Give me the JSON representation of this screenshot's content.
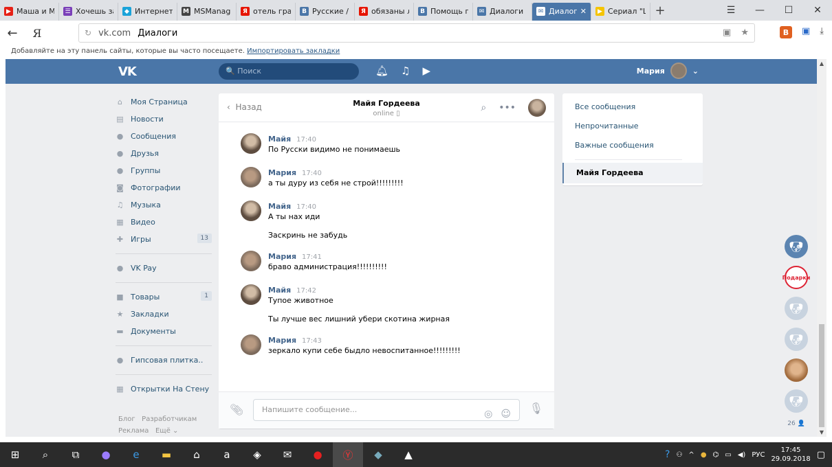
{
  "browser": {
    "tabs": [
      {
        "title": "Маша и М",
        "fav_color": "#e62117",
        "fav_glyph": "▶"
      },
      {
        "title": "Хочешь за",
        "fav_color": "#7a3fb8",
        "fav_glyph": "☰"
      },
      {
        "title": "Интернет",
        "fav_color": "#1aa3d9",
        "fav_glyph": "◆"
      },
      {
        "title": "MSManag",
        "fav_color": "#444444",
        "fav_glyph": "M"
      },
      {
        "title": "отель гра",
        "fav_color": "#e61400",
        "fav_glyph": "Я"
      },
      {
        "title": "Русские /",
        "fav_color": "#4a76a8",
        "fav_glyph": "В"
      },
      {
        "title": "обязаны л",
        "fav_color": "#e61400",
        "fav_glyph": "Я"
      },
      {
        "title": "Помощь п",
        "fav_color": "#4a76a8",
        "fav_glyph": "В"
      },
      {
        "title": "Диалоги",
        "fav_color": "#4a76a8",
        "fav_glyph": "✉"
      },
      {
        "title": "Диалоги",
        "fav_color": "#ffffff",
        "fav_glyph": "✉",
        "active": true
      },
      {
        "title": "Сериал \"Ш",
        "fav_color": "#f5c400",
        "fav_glyph": "▶"
      }
    ],
    "address": {
      "host": "vk.com",
      "page_title": "Диалоги"
    },
    "bookmarks_text": "Добавляйте на эту панель сайты, которые вы часто посещаете.",
    "bookmarks_link": "Импортировать закладки",
    "ext_label": "В"
  },
  "vk": {
    "logo": "VK",
    "search_placeholder": "Поиск",
    "user_name": "Мария",
    "sidebar": [
      {
        "label": "Моя Страница",
        "icon": "⌂"
      },
      {
        "label": "Новости",
        "icon": "▤"
      },
      {
        "label": "Сообщения",
        "icon": "●"
      },
      {
        "label": "Друзья",
        "icon": "●"
      },
      {
        "label": "Группы",
        "icon": "●"
      },
      {
        "label": "Фотографии",
        "icon": "◙"
      },
      {
        "label": "Музыка",
        "icon": "♫"
      },
      {
        "label": "Видео",
        "icon": "▦"
      },
      {
        "label": "Игры",
        "icon": "✚",
        "count": "13"
      },
      {
        "label": "VK Pay",
        "icon": "●"
      },
      {
        "label": "Товары",
        "icon": "■",
        "count": "1"
      },
      {
        "label": "Закладки",
        "icon": "★"
      },
      {
        "label": "Документы",
        "icon": "▬"
      },
      {
        "label": "Гипсовая плитка..",
        "icon": "●"
      },
      {
        "label": "Открытки На Стену",
        "icon": "▦"
      }
    ],
    "footer": {
      "blog": "Блог",
      "dev": "Разработчикам",
      "ads": "Реклама",
      "more": "Ещё ⌄"
    },
    "chat": {
      "back": "Назад",
      "peer_name": "Майя Гордеева",
      "peer_status": "online ▯",
      "messages": [
        {
          "author": "Майя",
          "time": "17:40",
          "text": "По Русски видимо не понимаешь",
          "ava": "a"
        },
        {
          "author": "Мария",
          "time": "17:40",
          "text": "а ты дуру из себя не строй!!!!!!!!!",
          "ava": "b"
        },
        {
          "author": "Майя",
          "time": "17:40",
          "text": "А ты нах иди",
          "text2": "Заскринь не забудь",
          "ava": "a"
        },
        {
          "author": "Мария",
          "time": "17:41",
          "text": "браво администрация!!!!!!!!!!",
          "ava": "b"
        },
        {
          "author": "Майя",
          "time": "17:42",
          "text": "Тупое животное",
          "text2": "Ты лучше вес лишний убери скотина жирная",
          "ava": "a"
        },
        {
          "author": "Мария",
          "time": "17:43",
          "text": "зеркало купи себе быдло невоспитанное!!!!!!!!!",
          "ava": "b"
        }
      ],
      "placeholder": "Напишите сообщение..."
    },
    "right_menu": {
      "items": [
        "Все сообщения",
        "Непрочитанные",
        "Важные сообщения"
      ],
      "active": "Майя Гордеева"
    },
    "friends_gift_text": "Подарки",
    "friends_count": "26 👤"
  },
  "taskbar": {
    "lang": "РУС",
    "time": "17:45",
    "date": "29.09.2018"
  }
}
